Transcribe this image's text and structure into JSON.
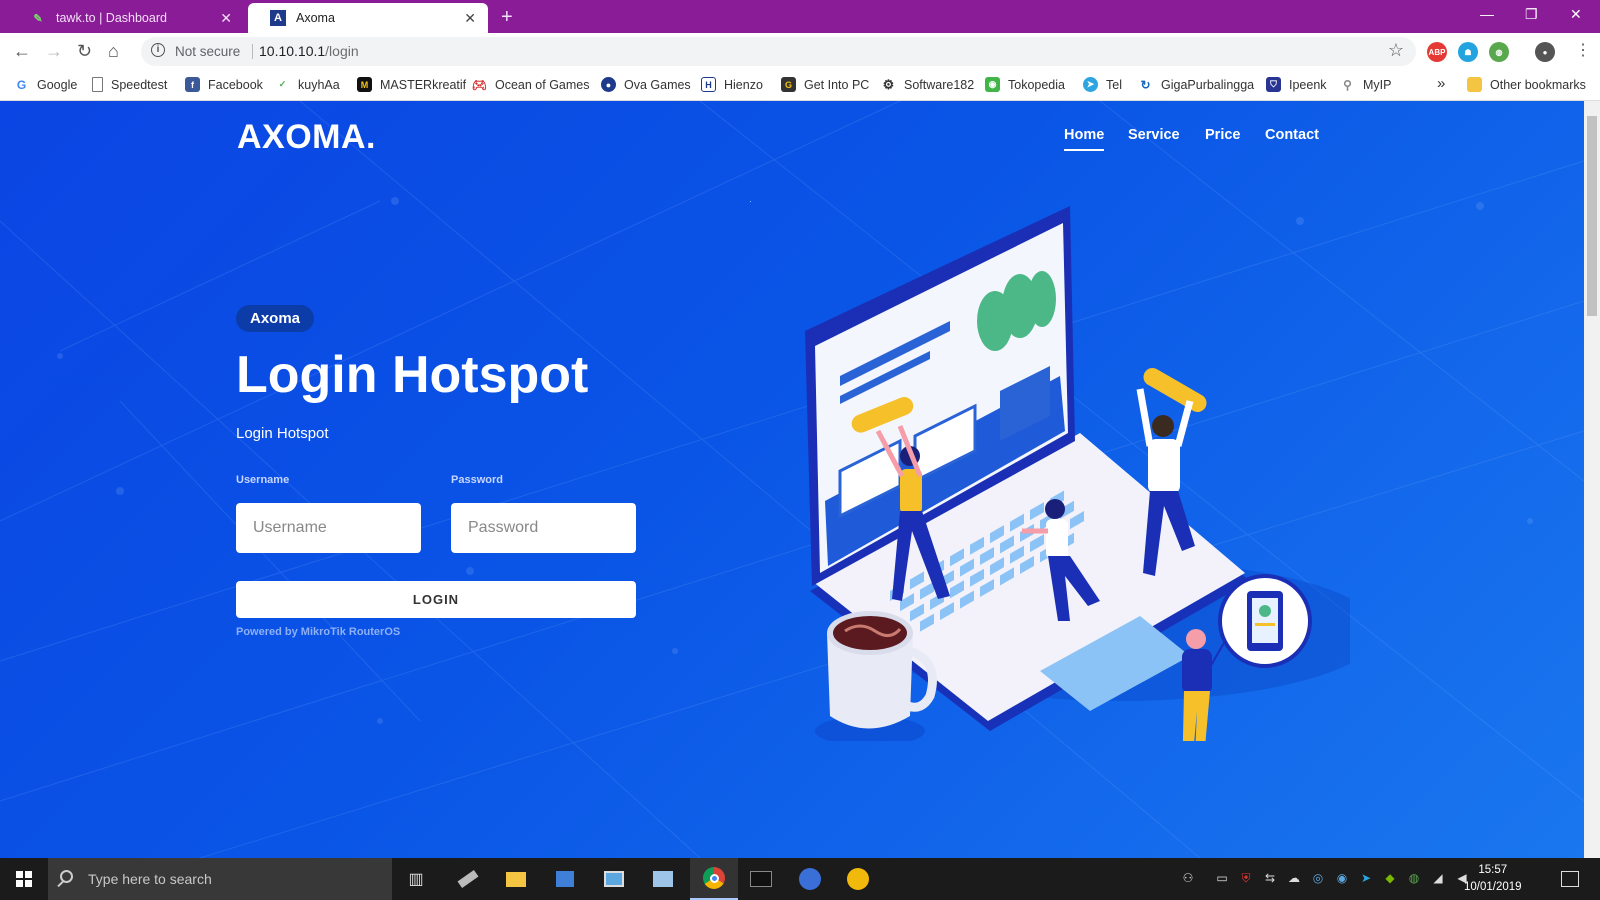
{
  "browser": {
    "tabs": [
      {
        "title": "tawk.to | Dashboard",
        "icon": "tawk-leaf-icon",
        "active": false
      },
      {
        "title": "Axoma",
        "icon": "axoma-a-icon",
        "active": true
      }
    ],
    "new_tab_label": "+",
    "address": {
      "security_label": "Not secure",
      "host": "10.10.10.1",
      "path": "/login"
    },
    "extensions": [
      "adblock-plus-icon",
      "ghostery-icon",
      "vpn-globe-icon",
      "profile-avatar-icon",
      "menu-icon"
    ],
    "bookmarks": [
      {
        "label": "Google",
        "icon": "google-icon",
        "color": "#4285f4"
      },
      {
        "label": "Speedtest",
        "icon": "page-icon",
        "color": "#777777"
      },
      {
        "label": "Facebook",
        "icon": "facebook-icon",
        "color": "#3b5998"
      },
      {
        "label": "kuyhAa",
        "icon": "kuyhaa-icon",
        "color": "#4caf50"
      },
      {
        "label": "MASTERkreatif",
        "icon": "masterkreatif-icon",
        "color": "#111111"
      },
      {
        "label": "Ocean of Games",
        "icon": "gamepad-icon",
        "color": "#d32f2f"
      },
      {
        "label": "Ova Games",
        "icon": "ova-games-icon",
        "color": "#1e3a8a"
      },
      {
        "label": "Hienzo",
        "icon": "hienzo-icon",
        "color": "#1e3a8a"
      },
      {
        "label": "Get Into PC",
        "icon": "getintopc-icon",
        "color": "#333333"
      },
      {
        "label": "Software182",
        "icon": "gear-icon",
        "color": "#333333"
      },
      {
        "label": "Tokopedia",
        "icon": "tokopedia-icon",
        "color": "#42b549"
      },
      {
        "label": "Tel",
        "icon": "telegram-icon",
        "color": "#2ca5e0"
      },
      {
        "label": "GigaPurbalingga",
        "icon": "giga-icon",
        "color": "#1565c0"
      },
      {
        "label": "Ipeenk",
        "icon": "shield-icon",
        "color": "#283593"
      },
      {
        "label": "MyIP",
        "icon": "search-icon",
        "color": "#888888"
      }
    ],
    "overflow_label": "»",
    "other_bookmarks_label": "Other bookmarks"
  },
  "page": {
    "logo": "AXOMA.",
    "nav": [
      "Home",
      "Service",
      "Price",
      "Contact"
    ],
    "badge": "Axoma",
    "title": "Login Hotspot",
    "subtitle": "Login Hotspot",
    "form": {
      "username_label": "Username",
      "username_placeholder": "Username",
      "password_label": "Password",
      "password_placeholder": "Password",
      "login_button": "LOGIN"
    },
    "powered_by": "Powered by MikroTik RouterOS",
    "accent_color": "#0a55e6"
  },
  "taskbar": {
    "search_placeholder": "Type here to search",
    "apps": [
      "task-view-icon",
      "usb-drive-icon",
      "file-explorer-icon",
      "network-app-icon",
      "control-panel-icon",
      "image-app-icon",
      "chrome-icon",
      "terminal-icon",
      "winbox-icon",
      "coin-app-icon"
    ],
    "clock_time": "15:57",
    "clock_date": "10/01/2019"
  }
}
